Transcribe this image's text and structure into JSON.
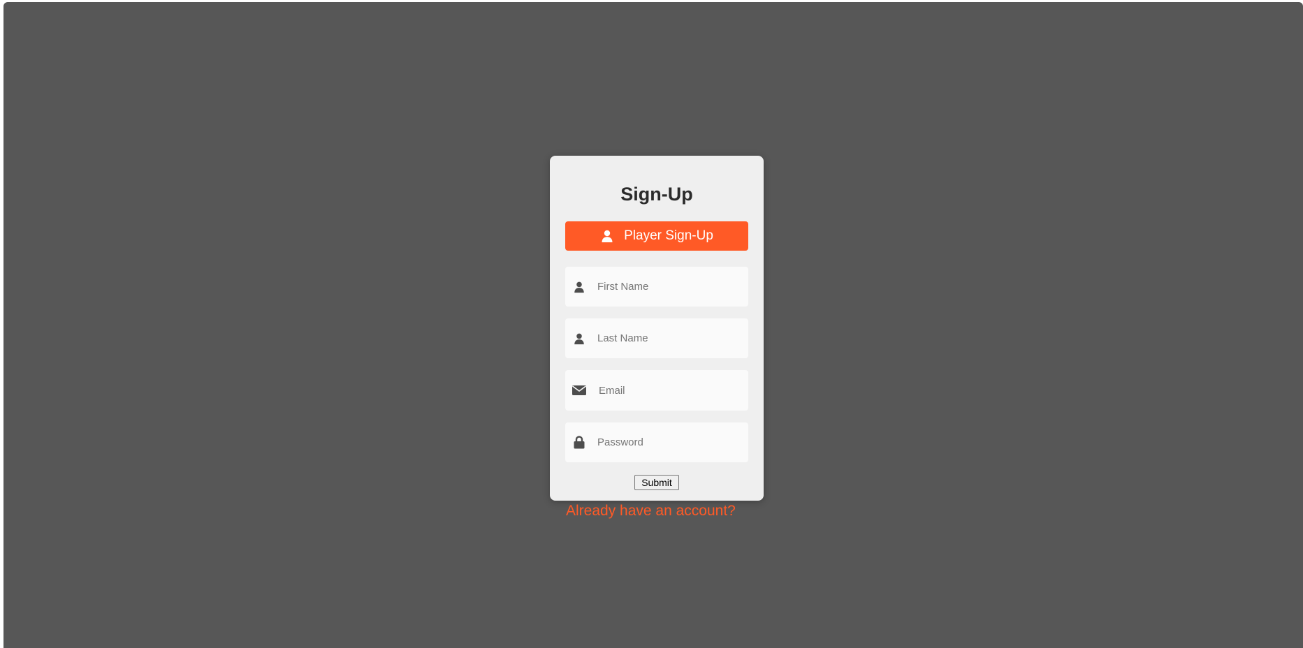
{
  "form": {
    "title": "Sign-Up",
    "player_button": {
      "label": "Player Sign-Up",
      "icon": "user-icon"
    },
    "fields": {
      "first_name": {
        "placeholder": "First Name",
        "icon": "user-icon"
      },
      "last_name": {
        "placeholder": "Last Name",
        "icon": "user-icon"
      },
      "email": {
        "placeholder": "Email",
        "icon": "envelope-icon"
      },
      "password": {
        "placeholder": "Password",
        "icon": "lock-icon"
      }
    },
    "submit_label": "Submit"
  },
  "login_link": "Already have an account?",
  "colors": {
    "background": "#575757",
    "card": "#efefef",
    "accent": "#ff5a26",
    "field": "#fafafa",
    "icon": "#4d4d4d"
  }
}
